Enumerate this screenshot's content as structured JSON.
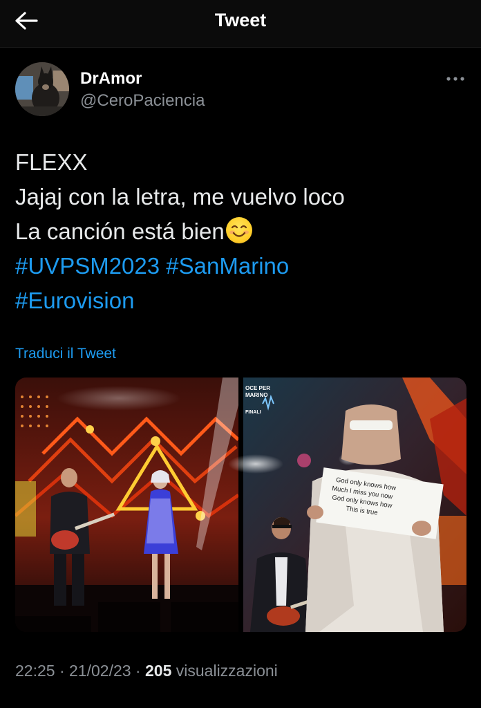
{
  "header": {
    "title": "Tweet",
    "back_icon": "arrow-left-icon"
  },
  "author": {
    "display_name": "DrAmor",
    "handle": "@CeroPaciencia",
    "more_icon": "more-horizontal-icon"
  },
  "tweet": {
    "lines": [
      {
        "text": "FLEXX"
      },
      {
        "text": "Jajaj con la letra, me vuelvo loco"
      },
      {
        "text": "La canción está bien",
        "emoji": "smiling-face-icon"
      }
    ],
    "hashtags": [
      "#UVPSM2023",
      "#SanMarino",
      "#Eurovision"
    ]
  },
  "translate_label": "Traduci il Tweet",
  "media": {
    "photo_right": {
      "sign_lines": [
        "God only knows how",
        "Much I miss you now",
        "God only knows how",
        "This is true"
      ],
      "logo_lines": [
        "OCE PER",
        "MARINO",
        "FINALI"
      ]
    }
  },
  "meta": {
    "time": "22:25",
    "separator": " · ",
    "date": "21/02/23",
    "views_count": "205",
    "views_label": " visualizzazioni"
  },
  "colors": {
    "background": "#000000",
    "text": "#e7e9ea",
    "secondary": "#8b9096",
    "link": "#1d9bf0"
  }
}
